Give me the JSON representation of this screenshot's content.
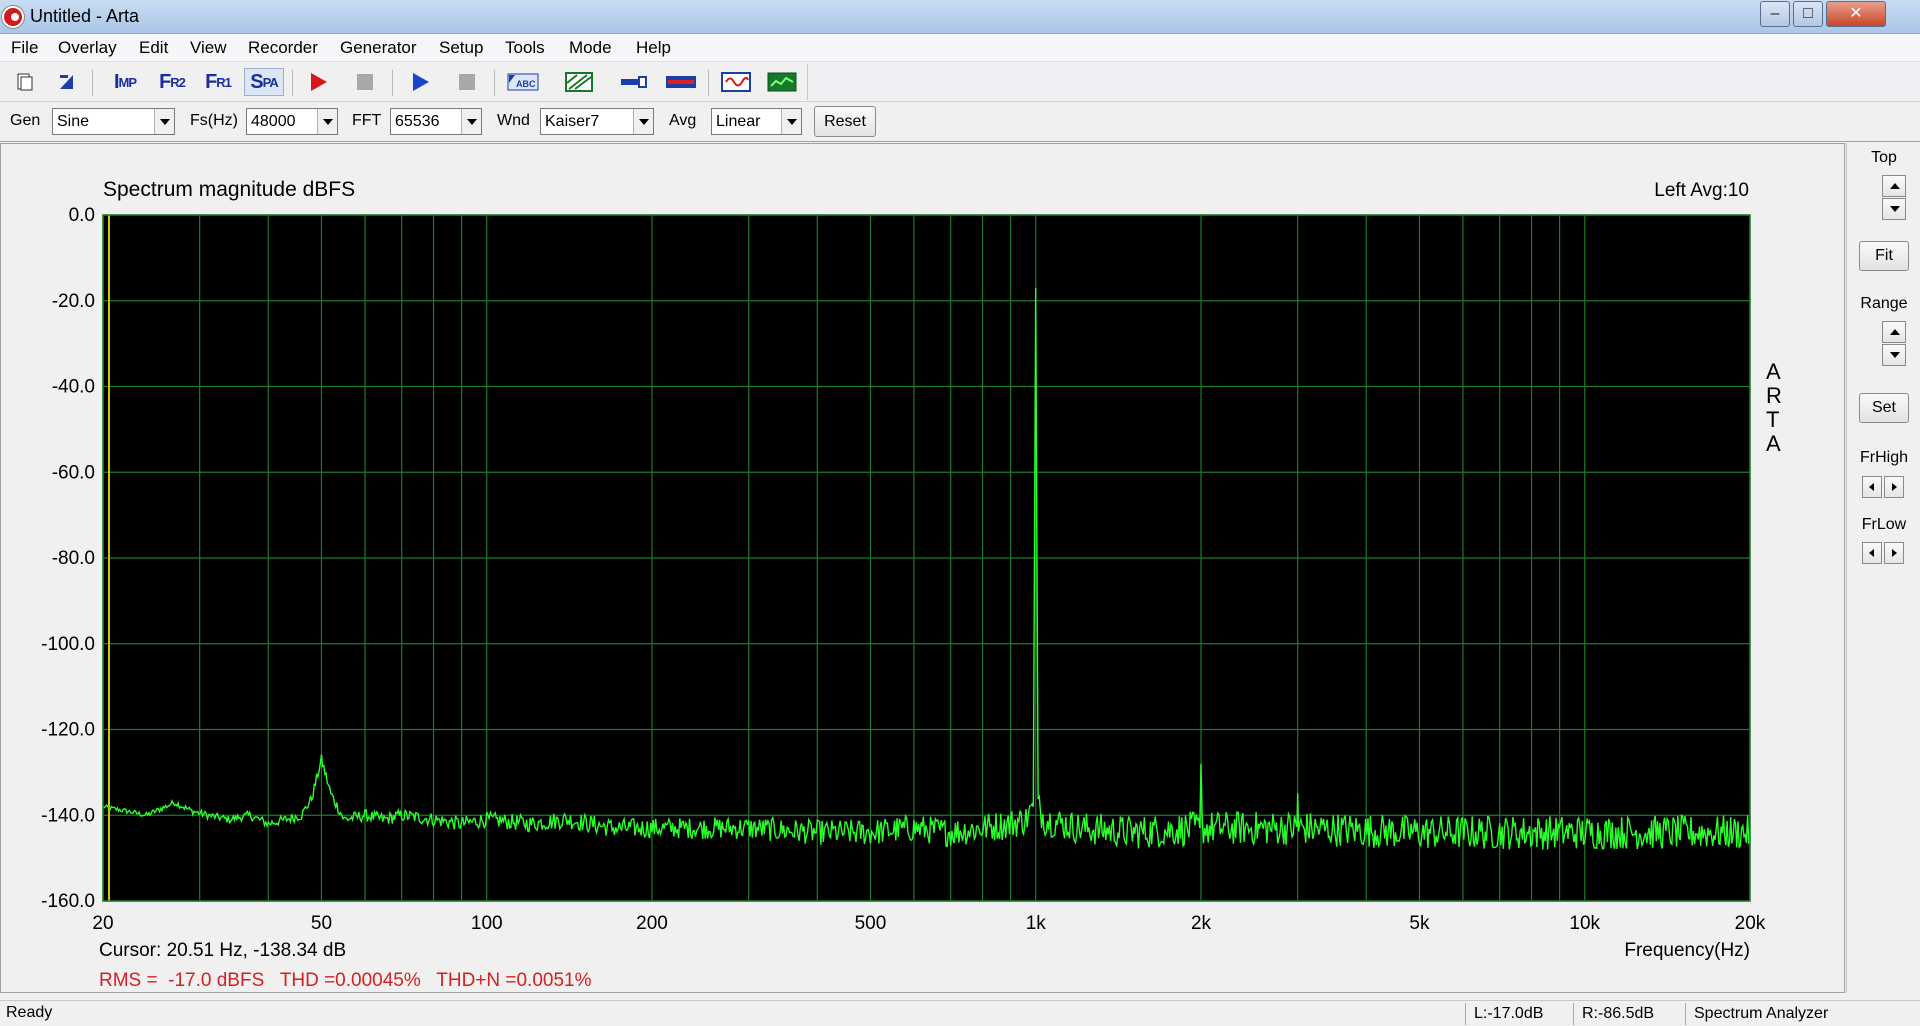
{
  "window": {
    "title": "Untitled - Arta",
    "minimize": "–",
    "maximize": "□",
    "close": "✕"
  },
  "menu": [
    "File",
    "Overlay",
    "Edit",
    "View",
    "Recorder",
    "Generator",
    "Setup",
    "Tools",
    "Mode",
    "Help"
  ],
  "toolbar": {
    "imp_big": "I",
    "imp_small": "MP",
    "fr2_big": "F",
    "fr2_small": "R2",
    "fr1_big": "F",
    "fr1_small": "R1",
    "spa_big": "S",
    "spa_small": "PA"
  },
  "controls": {
    "gen_label": "Gen",
    "gen_value": "Sine",
    "fs_label": "Fs(Hz)",
    "fs_value": "48000",
    "fft_label": "FFT",
    "fft_value": "65536",
    "wnd_label": "Wnd",
    "wnd_value": "Kaiser7",
    "avg_label": "Avg",
    "avg_value": "Linear",
    "reset_label": "Reset"
  },
  "right_panel": {
    "top_label": "Top",
    "fit_label": "Fit",
    "range_label": "Range",
    "set_label": "Set",
    "frhigh_label": "FrHigh",
    "frlow_label": "FrLow"
  },
  "readouts": {
    "cursor": "Cursor: 20.51 Hz, -138.34 dB",
    "rms": "RMS =  -17.0 dBFS   THD =0.00045%   THD+N =0.0051%",
    "channel_avg": "Left  Avg:10",
    "watermark": [
      "A",
      "R",
      "T",
      "A"
    ]
  },
  "status": {
    "ready": "Ready",
    "left_level": "L:-17.0dB",
    "right_level": "R:-86.5dB",
    "mode": "Spectrum Analyzer"
  },
  "colors": {
    "plot_bg": "#000000",
    "grid": "#1f7a2a",
    "trace": "#2bff2b",
    "cursor_line": "#c8c800",
    "stats_text": "#d42020"
  },
  "chart_data": {
    "type": "line",
    "title": "Spectrum magnitude dBFS",
    "xlabel": "Frequency(Hz)",
    "ylabel": "",
    "xscale": "log",
    "xlim": [
      20,
      20000
    ],
    "ylim": [
      -160,
      0
    ],
    "x_ticks": [
      {
        "value": 20,
        "label": "20"
      },
      {
        "value": 50,
        "label": "50"
      },
      {
        "value": 100,
        "label": "100"
      },
      {
        "value": 200,
        "label": "200"
      },
      {
        "value": 500,
        "label": "500"
      },
      {
        "value": 1000,
        "label": "1k"
      },
      {
        "value": 2000,
        "label": "2k"
      },
      {
        "value": 5000,
        "label": "5k"
      },
      {
        "value": 10000,
        "label": "10k"
      },
      {
        "value": 20000,
        "label": "20k"
      }
    ],
    "y_ticks": [
      {
        "value": 0,
        "label": "0.0"
      },
      {
        "value": -20,
        "label": "-20.0"
      },
      {
        "value": -40,
        "label": "-40.0"
      },
      {
        "value": -60,
        "label": "-60.0"
      },
      {
        "value": -80,
        "label": "-80.0"
      },
      {
        "value": -100,
        "label": "-100.0"
      },
      {
        "value": -120,
        "label": "-120.0"
      },
      {
        "value": -140,
        "label": "-140.0"
      },
      {
        "value": -160,
        "label": "-160.0"
      }
    ],
    "grid": true,
    "cursor_hz": 20.51,
    "series": [
      {
        "values": [
          {
            "x": 20,
            "y": -138
          },
          {
            "x": 22,
            "y": -139
          },
          {
            "x": 24,
            "y": -140
          },
          {
            "x": 26,
            "y": -138
          },
          {
            "x": 27,
            "y": -137
          },
          {
            "x": 29,
            "y": -139
          },
          {
            "x": 31,
            "y": -140
          },
          {
            "x": 34,
            "y": -141
          },
          {
            "x": 37,
            "y": -140
          },
          {
            "x": 40,
            "y": -142
          },
          {
            "x": 43,
            "y": -141
          },
          {
            "x": 46,
            "y": -140
          },
          {
            "x": 48,
            "y": -136
          },
          {
            "x": 50,
            "y": -127
          },
          {
            "x": 52,
            "y": -135
          },
          {
            "x": 55,
            "y": -141
          },
          {
            "x": 60,
            "y": -140
          },
          {
            "x": 65,
            "y": -141
          },
          {
            "x": 70,
            "y": -140
          },
          {
            "x": 80,
            "y": -141
          },
          {
            "x": 90,
            "y": -142
          },
          {
            "x": 100,
            "y": -141
          },
          {
            "x": 120,
            "y": -142
          },
          {
            "x": 140,
            "y": -141
          },
          {
            "x": 170,
            "y": -143
          },
          {
            "x": 200,
            "y": -143
          },
          {
            "x": 250,
            "y": -143
          },
          {
            "x": 300,
            "y": -143
          },
          {
            "x": 400,
            "y": -144
          },
          {
            "x": 500,
            "y": -144
          },
          {
            "x": 600,
            "y": -143
          },
          {
            "x": 700,
            "y": -144
          },
          {
            "x": 800,
            "y": -143
          },
          {
            "x": 900,
            "y": -142
          },
          {
            "x": 960,
            "y": -141
          },
          {
            "x": 990,
            "y": -138
          },
          {
            "x": 1000,
            "y": -17
          },
          {
            "x": 1010,
            "y": -138
          },
          {
            "x": 1040,
            "y": -141
          },
          {
            "x": 1200,
            "y": -143
          },
          {
            "x": 1500,
            "y": -144
          },
          {
            "x": 1990,
            "y": -143
          },
          {
            "x": 2000,
            "y": -128
          },
          {
            "x": 2010,
            "y": -143
          },
          {
            "x": 2990,
            "y": -143
          },
          {
            "x": 3000,
            "y": -135
          },
          {
            "x": 3010,
            "y": -143
          },
          {
            "x": 5000,
            "y": -144
          },
          {
            "x": 7000,
            "y": -144
          },
          {
            "x": 10000,
            "y": -144
          },
          {
            "x": 15000,
            "y": -144
          },
          {
            "x": 20000,
            "y": -144
          }
        ]
      }
    ]
  }
}
